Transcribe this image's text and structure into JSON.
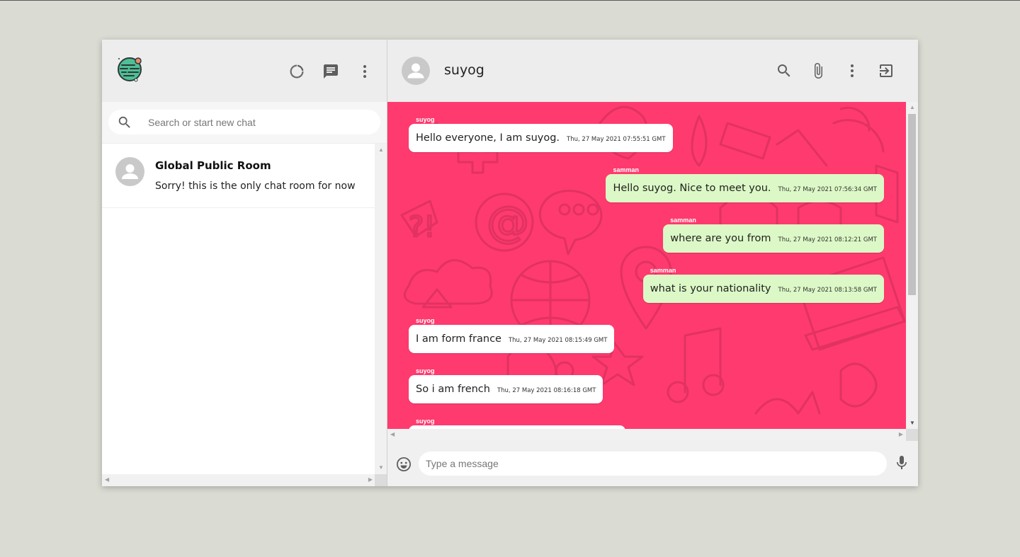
{
  "sidebar": {
    "search": {
      "placeholder": "Search or start new chat"
    },
    "chats": [
      {
        "name": "Global Public Room",
        "last_message": "Sorry! this is the only chat room for now"
      }
    ]
  },
  "header": {
    "title": "suyog"
  },
  "messages": [
    {
      "sender": "suyog",
      "text": "Hello everyone, I am suyog.",
      "time": "Thu, 27 May 2021 07:55:51 GMT",
      "direction": "in"
    },
    {
      "sender": "samman",
      "text": "Hello suyog. Nice to meet you.",
      "time": "Thu, 27 May 2021 07:56:34 GMT",
      "direction": "out"
    },
    {
      "sender": "samman",
      "text": "where are you from",
      "time": "Thu, 27 May 2021 08:12:21 GMT",
      "direction": "out"
    },
    {
      "sender": "samman",
      "text": "what is your nationality",
      "time": "Thu, 27 May 2021 08:13:58 GMT",
      "direction": "out"
    },
    {
      "sender": "suyog",
      "text": "I am form france",
      "time": "Thu, 27 May 2021 08:15:49 GMT",
      "direction": "in"
    },
    {
      "sender": "suyog",
      "text": "So i am french",
      "time": "Thu, 27 May 2021 08:16:18 GMT",
      "direction": "in"
    },
    {
      "sender": "suyog",
      "text": "",
      "time": "",
      "direction": "in"
    }
  ],
  "composer": {
    "placeholder": "Type a message"
  },
  "colors": {
    "chat_background": "#ff3a6e",
    "outgoing_bubble": "#dcf8c6",
    "incoming_bubble": "#ffffff",
    "header_background": "#ededed",
    "page_background": "#dadbd3"
  },
  "icons": {
    "sidebar_header": [
      "status-icon",
      "new-chat-icon",
      "menu-dots-icon"
    ],
    "chat_header": [
      "search-icon",
      "attach-icon",
      "menu-dots-icon",
      "logout-icon"
    ],
    "composer": [
      "emoji-icon",
      "mic-icon"
    ]
  }
}
